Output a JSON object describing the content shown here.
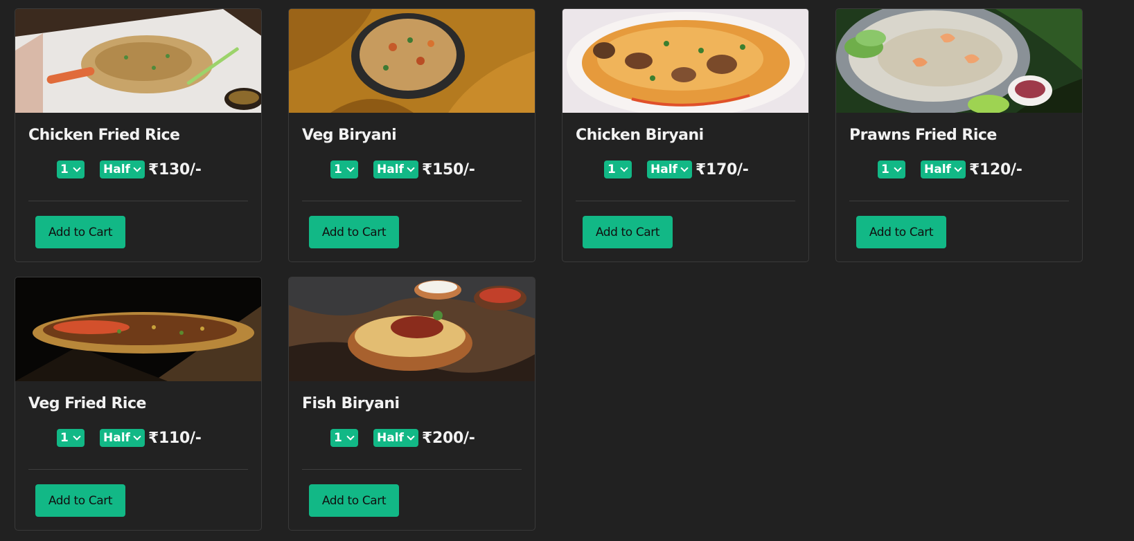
{
  "menu": {
    "items": [
      {
        "name": "Chicken Fried Rice",
        "qty": "1",
        "size": "Half",
        "price": "₹130/-",
        "button": "Add to Cart",
        "image": "chicken-fried-rice-photo"
      },
      {
        "name": "Veg Biryani",
        "qty": "1",
        "size": "Half",
        "price": "₹150/-",
        "button": "Add to Cart",
        "image": "veg-biryani-photo"
      },
      {
        "name": "Chicken Biryani",
        "qty": "1",
        "size": "Half",
        "price": "₹170/-",
        "button": "Add to Cart",
        "image": "chicken-biryani-photo"
      },
      {
        "name": "Prawns Fried Rice",
        "qty": "1",
        "size": "Half",
        "price": "₹120/-",
        "button": "Add to Cart",
        "image": "prawns-fried-rice-photo"
      },
      {
        "name": "Veg Fried Rice",
        "qty": "1",
        "size": "Half",
        "price": "₹110/-",
        "button": "Add to Cart",
        "image": "veg-fried-rice-photo"
      },
      {
        "name": "Fish Biryani",
        "qty": "1",
        "size": "Half",
        "price": "₹200/-",
        "button": "Add to Cart",
        "image": "fish-biryani-photo"
      }
    ]
  },
  "colors": {
    "background": "#212121",
    "accent": "#12b886",
    "card_border": "#3a3a3a"
  }
}
